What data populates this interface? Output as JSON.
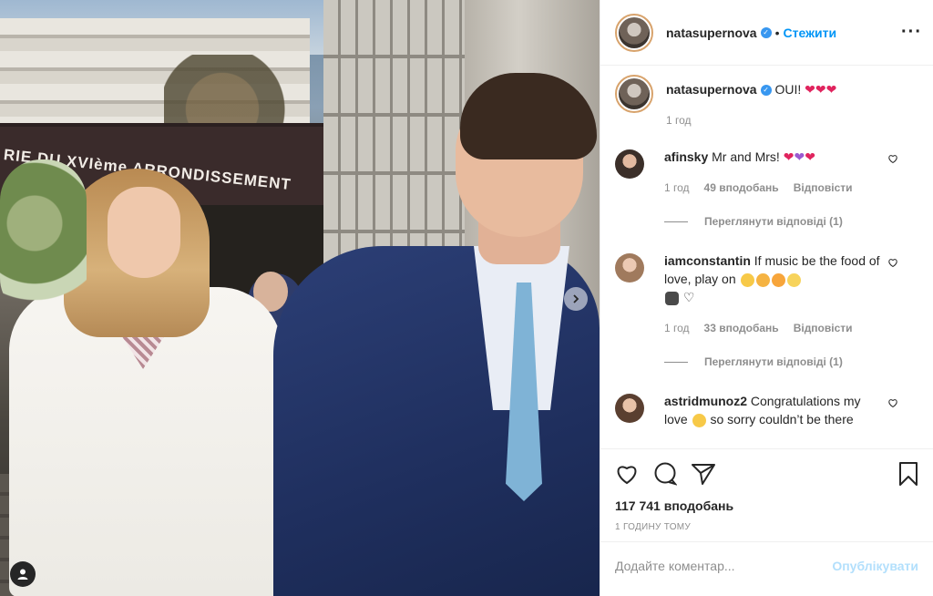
{
  "photo": {
    "awning_text": "RIE DU XVIème ARRONDISSEMENT",
    "next_icon": "chevron-right-icon",
    "tag_icon": "user-tag-icon"
  },
  "header": {
    "username": "natasupernova",
    "verified_icon": "verified-badge-icon",
    "separator": "•",
    "follow_label": "Стежити",
    "more_icon": "more-options-icon"
  },
  "caption": {
    "username": "natasupernova",
    "text": "OUI!",
    "emojis": [
      "heart-emoji",
      "heart-emoji",
      "heart-emoji"
    ],
    "time": "1 год"
  },
  "comments": [
    {
      "username": "afinsky",
      "text": "Mr and Mrs!",
      "emojis": [
        "red-heart-emoji",
        "purple-heart-emoji",
        "red-heart-emoji"
      ],
      "time": "1 год",
      "likes": "49 вподобань",
      "reply_label": "Відповісти",
      "view_replies": "Переглянути відповіді (1)"
    },
    {
      "username": "iamconstantin",
      "text": "If music be the food of love, play on",
      "emojis": [
        "zany-face-emoji",
        "smiling-face-with-hearts-emoji",
        "star-struck-emoji",
        "tears-of-joy-emoji",
        "man-in-tuxedo-emoji",
        "white-heart-emoji"
      ],
      "time": "1 год",
      "likes": "33 вподобань",
      "reply_label": "Відповісти",
      "view_replies": "Переглянути відповіді (1)"
    },
    {
      "username": "astridmunoz2",
      "text_before": "Congratulations my love",
      "emojis": [
        "heart-eyes-emoji"
      ],
      "text_after": "so sorry couldn’t be there"
    }
  ],
  "actions": {
    "like_icon": "heart-icon",
    "comment_icon": "comment-icon",
    "share_icon": "share-icon",
    "save_icon": "bookmark-icon",
    "likes_count": "117 741 вподобань",
    "time_ago": "1 ГОДИНУ ТОМУ"
  },
  "comment_bar": {
    "placeholder": "Додайте коментар...",
    "post_label": "Опублікувати"
  },
  "colors": {
    "accent": "#0095f6",
    "verified": "#3897f0",
    "muted": "#8e8e8e"
  }
}
